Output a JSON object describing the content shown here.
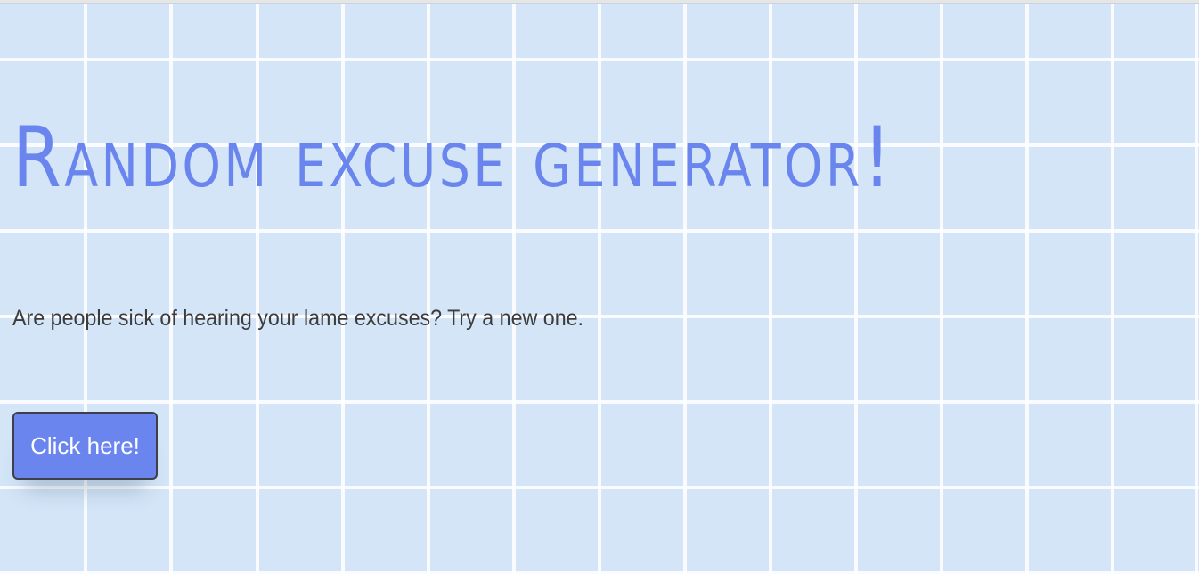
{
  "page": {
    "title": "Random excuse generator!",
    "subtitle": "Are people sick of hearing your lame excuses? Try a new one.",
    "button_label": "Click here!"
  },
  "colors": {
    "background": "#d3e5f7",
    "grid_line": "#ffffff",
    "title_text": "#6a86ee",
    "body_text": "#3c3c3c",
    "button_bg": "#6a86ee",
    "button_text": "#ffffff",
    "button_border": "#3f3f4a"
  }
}
